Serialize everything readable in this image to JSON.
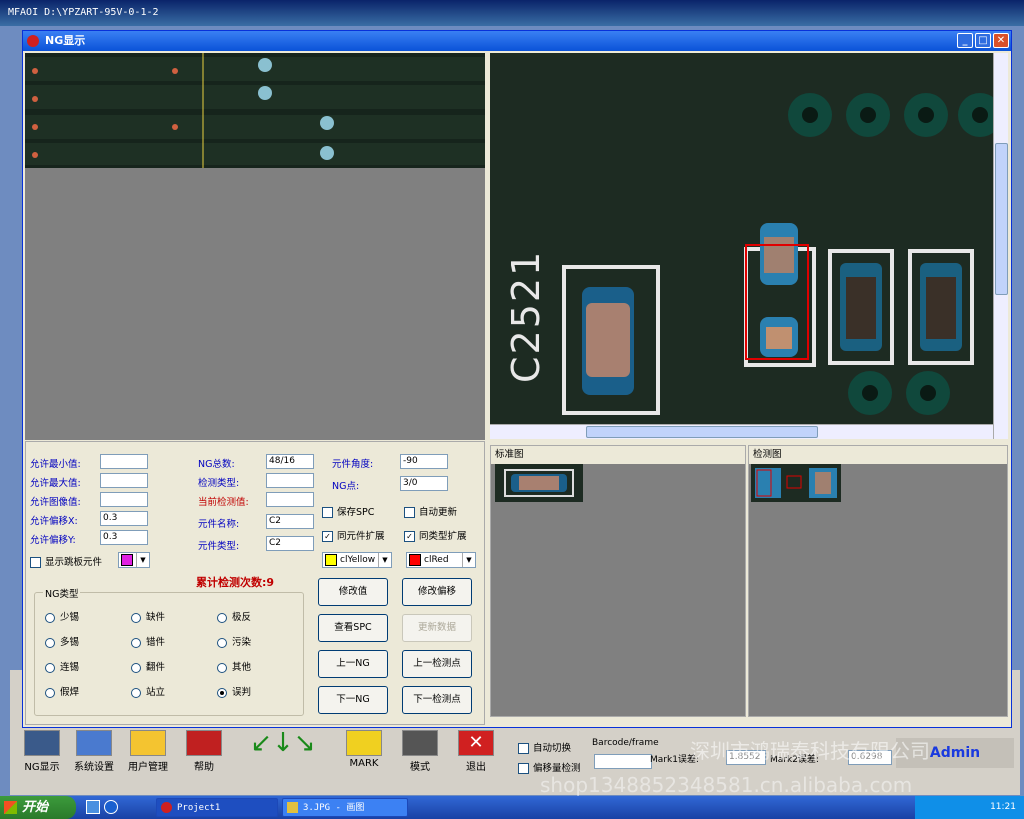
{
  "app": {
    "title": "MFAOI    D:\\YPZART-95V-0-1-2"
  },
  "dialog": {
    "title": "NG显示"
  },
  "zoom_view": {
    "silkscreen_label": "C2521"
  },
  "params": {
    "allow_min_label": "允许最小值:",
    "allow_max_label": "允许最大值:",
    "allow_image_label": "允许图像值:",
    "allow_offset_x_label": "允许偏移X:",
    "allow_offset_x_value": "0.3",
    "allow_offset_y_label": "允许偏移Y:",
    "allow_offset_y_value": "0.3",
    "ng_total_label": "NG总数:",
    "ng_total_value": "48/16",
    "detect_type_label": "检测类型:",
    "current_value_label": "当前检测值:",
    "component_name_label": "元件名称:",
    "component_name_value": "C2",
    "component_type_label": "元件类型:",
    "component_type_value": "C2",
    "angle_label": "元件角度:",
    "angle_value": "-90",
    "ng_point_label": "NG点:",
    "ng_point_value": "3/0",
    "show_skip_label": "显示跳板元件",
    "save_spc_label": "保存SPC",
    "auto_update_label": "自动更新",
    "same_comp_label": "同元件扩展",
    "same_type_label": "同类型扩展",
    "color1_label": "clYellow",
    "color2_label": "clRed",
    "cumulative_label": "累计检测次数:9"
  },
  "ng_types": {
    "group_label": "NG类型",
    "options": [
      "少锡",
      "缺件",
      "极反",
      "多锡",
      "错件",
      "污染",
      "连锡",
      "翻件",
      "其他",
      "假焊",
      "站立",
      "误判"
    ],
    "selected": "误判"
  },
  "buttons": {
    "modify_value": "修改值",
    "modify_offset": "修改偏移",
    "view_spc": "查看SPC",
    "update_data": "更新数据",
    "prev_ng": "上一NG",
    "prev_point": "上一检测点",
    "next_ng": "下一NG",
    "next_point": "下一检测点"
  },
  "panes": {
    "standard": "标准图",
    "detect": "检测图"
  },
  "toolbar": {
    "ng_display": "NG显示",
    "system_settings": "系统设置",
    "user_mgmt": "用户管理",
    "help": "帮助",
    "mark": "MARK",
    "mode": "模式",
    "exit": "退出",
    "auto_switch": "自动切换",
    "offset_detect": "偏移量检测",
    "barcode": "Barcode/frame",
    "mark1_err": "Mark1误差:",
    "mark1_val": "1.8552",
    "mark2_err": "Mark2误差:",
    "mark2_val": "0.6298",
    "admin": "Admin"
  },
  "watermark": {
    "line1": "深圳市鸿瑞泰科技有限公司",
    "line2": "shop1348852348581.cn.alibaba.com"
  },
  "taskbar": {
    "start": "开始",
    "item1": "Project1",
    "item2": "3.JPG - 画图",
    "time": "11:21"
  }
}
